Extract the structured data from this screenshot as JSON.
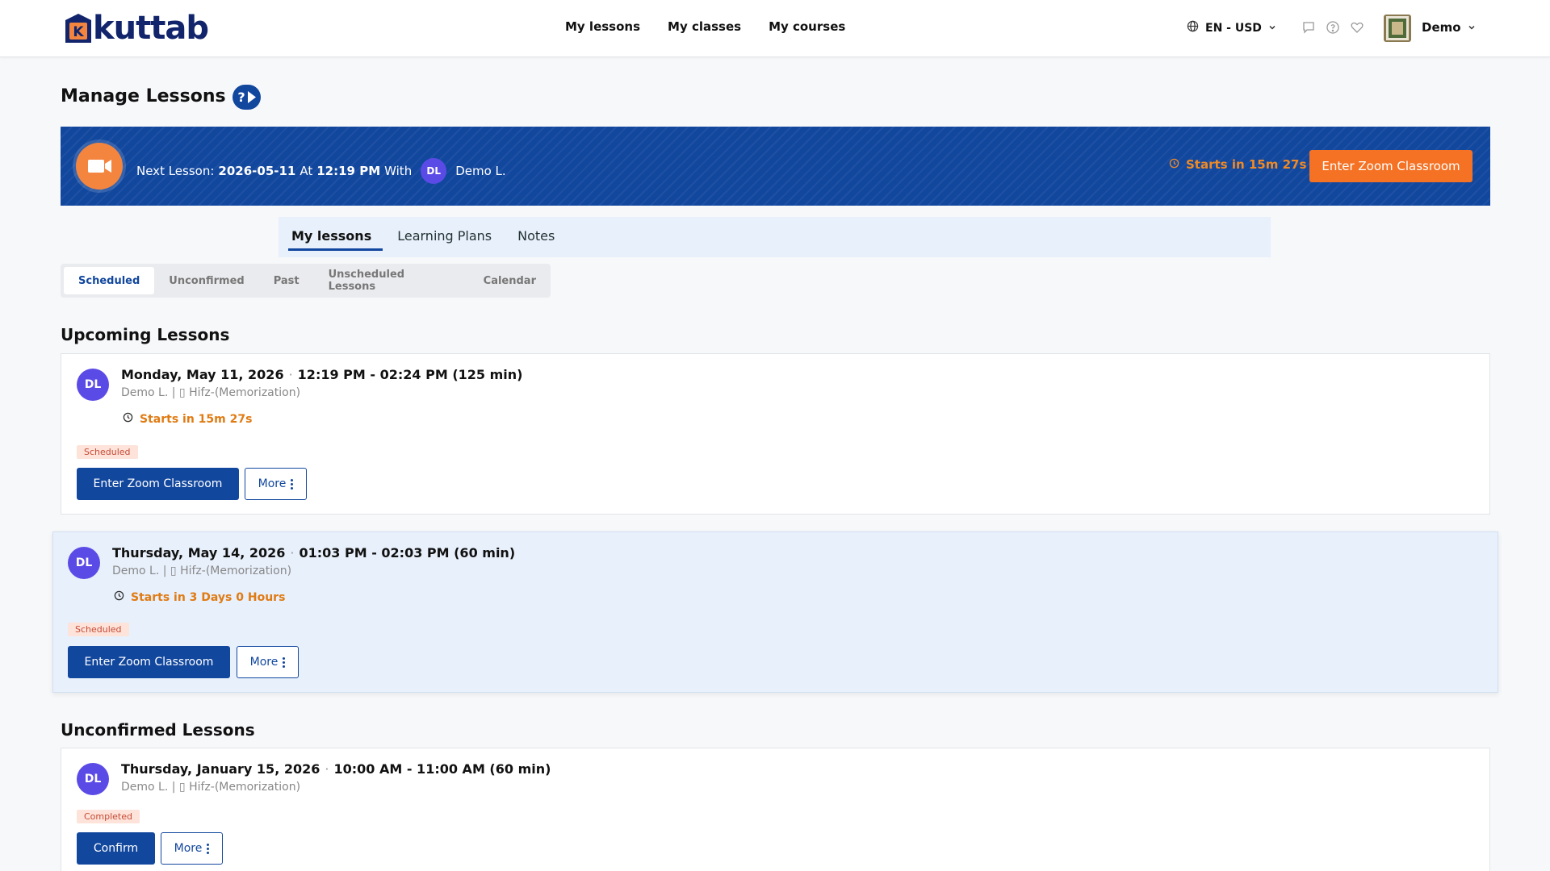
{
  "brand": {
    "name": "kuttab",
    "mark_letter": "K"
  },
  "nav": {
    "items": [
      "My lessons",
      "My classes",
      "My courses"
    ]
  },
  "header": {
    "language_currency": "EN - USD",
    "user_name": "Demo"
  },
  "page": {
    "title": "Manage Lessons",
    "help_label": "?"
  },
  "banner": {
    "prefix": "Next Lesson:",
    "date": "2026-05-11",
    "at": "At",
    "time": "12:19 PM",
    "with": "With",
    "initials": "DL",
    "teacher": "Demo L.",
    "starts_in": "Starts in 15m 27s",
    "button": "Enter Zoom Classroom"
  },
  "tabs": {
    "items": [
      "My lessons",
      "Learning Plans",
      "Notes"
    ],
    "active": "My lessons"
  },
  "subtabs": {
    "items": [
      "Scheduled",
      "Unconfirmed",
      "Past",
      "Unscheduled Lessons",
      "Calendar"
    ],
    "active": "Scheduled"
  },
  "upcoming": {
    "heading": "Upcoming Lessons",
    "lessons": [
      {
        "initials": "DL",
        "date": "Monday, May 11, 2026",
        "time": "12:19 PM - 02:24 PM (125 min)",
        "teacher_course": "Demo L. | ▯ Hifz-(Memorization)",
        "starts_in": "Starts in 15m 27s",
        "status": "Scheduled",
        "primary_button": "Enter Zoom Classroom",
        "more_button": "More"
      },
      {
        "initials": "DL",
        "date": "Thursday, May 14, 2026",
        "time": "01:03 PM - 02:03 PM (60 min)",
        "teacher_course": "Demo L. | ▯ Hifz-(Memorization)",
        "starts_in": "Starts in 3 Days 0 Hours",
        "status": "Scheduled",
        "primary_button": "Enter Zoom Classroom",
        "more_button": "More"
      }
    ]
  },
  "unconfirmed": {
    "heading": "Unconfirmed Lessons",
    "lessons": [
      {
        "initials": "DL",
        "date": "Thursday, January 15, 2026",
        "time": "10:00 AM - 11:00 AM (60 min)",
        "teacher_course": "Demo L. | ▯ Hifz-(Memorization)",
        "status": "Completed",
        "primary_button": "Confirm",
        "more_button": "More"
      }
    ]
  },
  "colors": {
    "primary": "#12479e",
    "accent": "#f57224",
    "avatar": "#5b4be6",
    "warning_text": "#e07b14"
  }
}
